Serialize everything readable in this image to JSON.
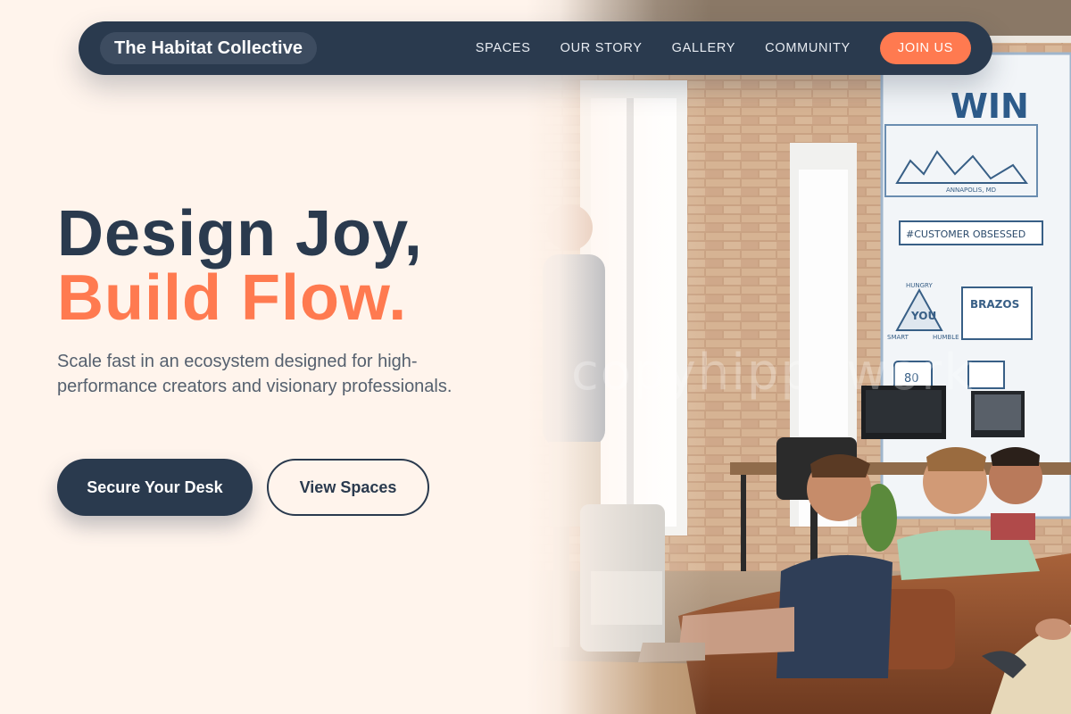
{
  "nav": {
    "brand": "The Habitat Collective",
    "links": [
      "SPACES",
      "OUR STORY",
      "GALLERY",
      "COMMUNITY"
    ],
    "cta": "JOIN US"
  },
  "hero": {
    "headline_line1": "Design Joy,",
    "headline_line2": "Build Flow.",
    "subtext": "Scale fast in an ecosystem designed for high-performance creators and visionary professionals.",
    "primary_button": "Secure Your Desk",
    "secondary_button": "View Spaces"
  },
  "photo": {
    "wall_sign": "WIN",
    "mural_city": "ANNAPOLIS, MD",
    "mural_tag": "#CUSTOMER OBSESSED",
    "mural_words": [
      "HUNGRY",
      "YOU",
      "SMART",
      "HUMBLE"
    ],
    "mural_brand": "BRAZOS",
    "mural_number": "80",
    "watermark": "copyhippowork"
  },
  "colors": {
    "navy": "#2a3a4e",
    "accent": "#ff7a50",
    "background": "#fff4ec",
    "body_text": "#55606e"
  }
}
